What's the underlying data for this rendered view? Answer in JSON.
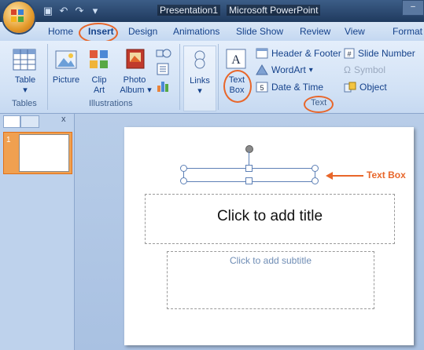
{
  "title_bar": {
    "doc_name": "Presentation1",
    "app_name": "Microsoft PowerPoint",
    "quick_access": [
      "save-icon",
      "undo-icon",
      "redo-icon",
      "customize-icon"
    ]
  },
  "tabs": [
    {
      "label": "Home"
    },
    {
      "label": "Insert",
      "active": true
    },
    {
      "label": "Design"
    },
    {
      "label": "Animations"
    },
    {
      "label": "Slide Show"
    },
    {
      "label": "Review"
    },
    {
      "label": "View"
    },
    {
      "label": "Format"
    }
  ],
  "ribbon": {
    "tables": {
      "group_label": "Tables",
      "table_line1": "Table",
      "table_arrow": "▾"
    },
    "illustrations": {
      "group_label": "Illustrations",
      "picture": "Picture",
      "clipart_line1": "Clip",
      "clipart_line2": "Art",
      "photo_line1": "Photo",
      "photo_line2": "Album",
      "photo_arrow": "▾"
    },
    "links": {
      "label": "Links",
      "arrow": "▾"
    },
    "text": {
      "group_label": "Text",
      "textbox_line1": "Text",
      "textbox_line2": "Box",
      "header_footer": "Header & Footer",
      "wordart": "WordArt",
      "wordart_arrow": "▾",
      "date_time": "Date & Time",
      "slide_number": "Slide Number",
      "symbol": "Symbol",
      "object": "Object"
    }
  },
  "slides_pane": {
    "close": "x",
    "slide_number": "1"
  },
  "slide": {
    "title_placeholder": "Click to add title",
    "subtitle_placeholder": "Click to add subtitle"
  },
  "annotation": {
    "label": "Text Box",
    "color": "#e8662a"
  }
}
